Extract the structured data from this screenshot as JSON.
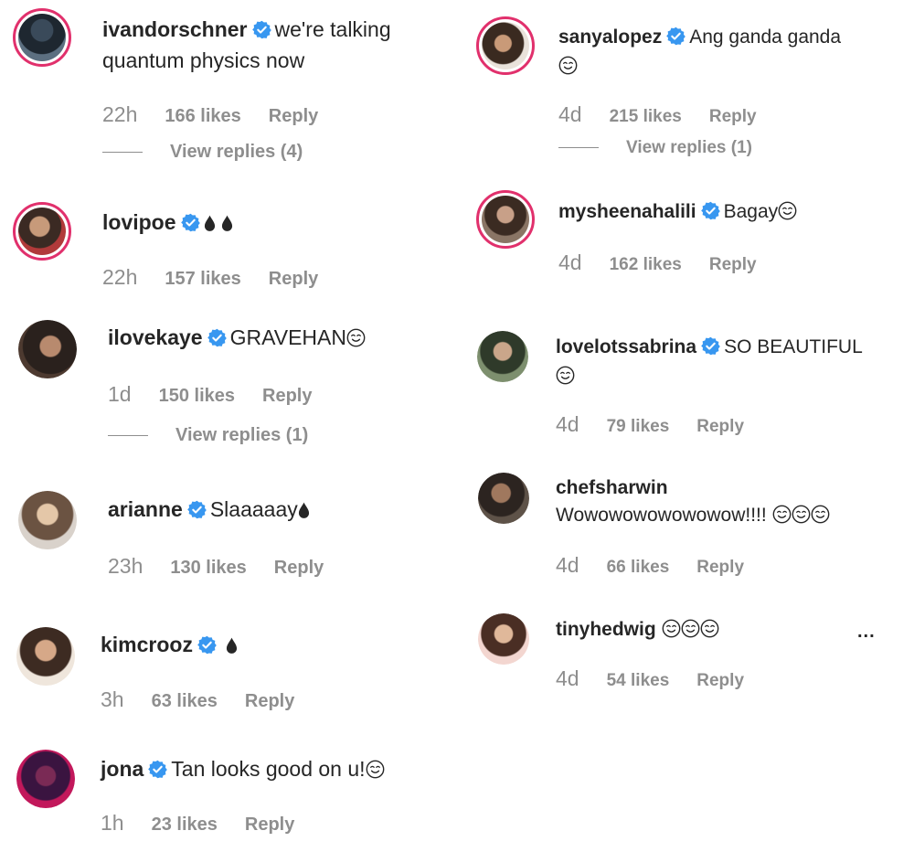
{
  "colors": {
    "verified": "#3897f0",
    "muted": "#8e8e8e",
    "text": "#262626",
    "ring": "#e1306c"
  },
  "comments": [
    {
      "username": "ivandorschner",
      "text": "we're talking",
      "text2": "quantum physics now",
      "time": "22h",
      "likes": "166 likes",
      "reply": "Reply",
      "view_replies": "View replies (4)"
    },
    {
      "username": "lovipoe",
      "time": "22h",
      "likes": "157 likes",
      "reply": "Reply"
    },
    {
      "username": "ilovekaye",
      "text": "GRAVEHAN",
      "time": "1d",
      "likes": "150 likes",
      "reply": "Reply",
      "view_replies": "View replies (1)"
    },
    {
      "username": "arianne",
      "text": "Slaaaaay",
      "time": "23h",
      "likes": "130 likes",
      "reply": "Reply"
    },
    {
      "username": "kimcrooz",
      "time": "3h",
      "likes": "63 likes",
      "reply": "Reply"
    },
    {
      "username": "jona",
      "text": "Tan looks good on u!",
      "time": "1h",
      "likes": "23 likes",
      "reply": "Reply"
    },
    {
      "username": "sanyalopez",
      "text": "Ang ganda ganda",
      "time": "4d",
      "likes": "215 likes",
      "reply": "Reply",
      "view_replies": "View replies (1)"
    },
    {
      "username": "mysheenahalili",
      "text": "Bagay",
      "time": "4d",
      "likes": "162 likes",
      "reply": "Reply"
    },
    {
      "username": "lovelotssabrina",
      "text": "SO BEAUTIFUL",
      "time": "4d",
      "likes": "79 likes",
      "reply": "Reply"
    },
    {
      "username": "chefsharwin",
      "text": "Wowowowowowowow!!!!",
      "time": "4d",
      "likes": "66 likes",
      "reply": "Reply"
    },
    {
      "username": "tinyhedwig",
      "time": "4d",
      "likes": "54 likes",
      "reply": "Reply",
      "more": "..."
    }
  ]
}
